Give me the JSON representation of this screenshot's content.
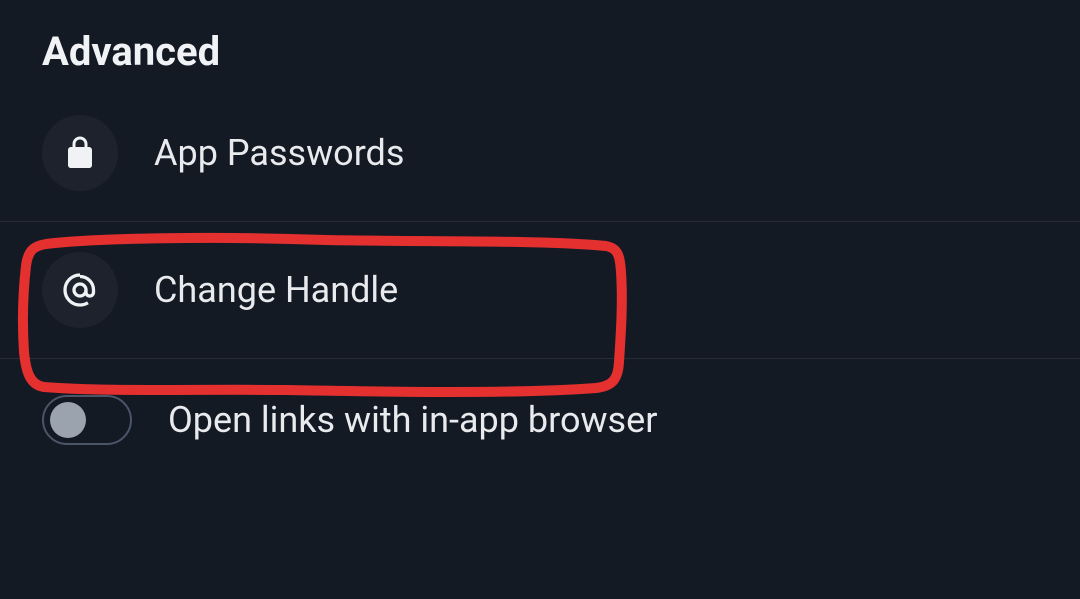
{
  "section": {
    "title": "Advanced"
  },
  "items": {
    "appPasswords": {
      "label": "App Passwords",
      "icon": "lock"
    },
    "changeHandle": {
      "label": "Change Handle",
      "icon": "at"
    },
    "openLinks": {
      "label": "Open links with in-app browser",
      "toggleState": "off"
    }
  },
  "annotation": {
    "color": "#e83030",
    "target": "changeHandle"
  }
}
